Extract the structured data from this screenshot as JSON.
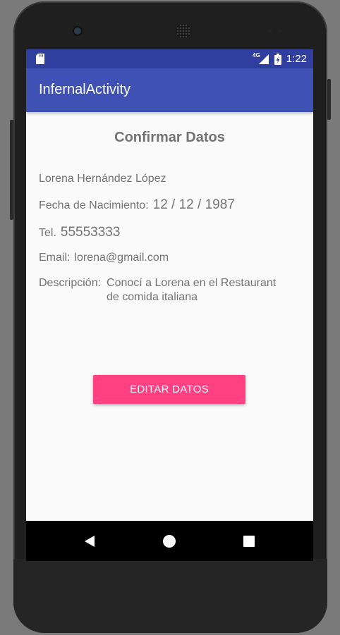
{
  "status_bar": {
    "network_label": "4G",
    "time": "1:22",
    "icons": [
      "sd-card-icon",
      "signal-icon",
      "battery-icon"
    ]
  },
  "app_bar": {
    "title": "InfernalActivity",
    "color": "#3f51b5"
  },
  "content": {
    "heading": "Confirmar Datos",
    "name": "Lorena Hernández López",
    "birth_label": "Fecha de Nacimiento:",
    "birth_value": "12 / 12 / 1987",
    "phone_label": "Tel.",
    "phone_value": "55553333",
    "email_label": "Email:",
    "email_value": "lorena@gmail.com",
    "description_label": "Descripción:",
    "description_value": "Conocí a Lorena en el Restaurant de comida italiana"
  },
  "actions": {
    "edit_label": "EDITAR DATOS",
    "edit_color": "#ff4081"
  },
  "nav_bar": {
    "icons": [
      "back-icon",
      "home-icon",
      "recents-icon"
    ]
  }
}
